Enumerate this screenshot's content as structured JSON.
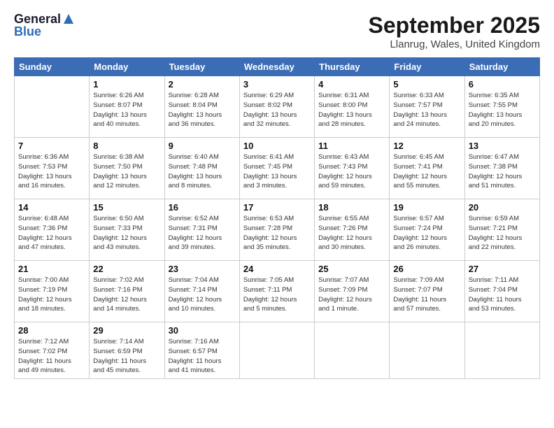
{
  "header": {
    "logo_line1": "General",
    "logo_line2": "Blue",
    "month": "September 2025",
    "location": "Llanrug, Wales, United Kingdom"
  },
  "weekdays": [
    "Sunday",
    "Monday",
    "Tuesday",
    "Wednesday",
    "Thursday",
    "Friday",
    "Saturday"
  ],
  "weeks": [
    [
      {
        "day": "",
        "info": ""
      },
      {
        "day": "1",
        "info": "Sunrise: 6:26 AM\nSunset: 8:07 PM\nDaylight: 13 hours\nand 40 minutes."
      },
      {
        "day": "2",
        "info": "Sunrise: 6:28 AM\nSunset: 8:04 PM\nDaylight: 13 hours\nand 36 minutes."
      },
      {
        "day": "3",
        "info": "Sunrise: 6:29 AM\nSunset: 8:02 PM\nDaylight: 13 hours\nand 32 minutes."
      },
      {
        "day": "4",
        "info": "Sunrise: 6:31 AM\nSunset: 8:00 PM\nDaylight: 13 hours\nand 28 minutes."
      },
      {
        "day": "5",
        "info": "Sunrise: 6:33 AM\nSunset: 7:57 PM\nDaylight: 13 hours\nand 24 minutes."
      },
      {
        "day": "6",
        "info": "Sunrise: 6:35 AM\nSunset: 7:55 PM\nDaylight: 13 hours\nand 20 minutes."
      }
    ],
    [
      {
        "day": "7",
        "info": "Sunrise: 6:36 AM\nSunset: 7:53 PM\nDaylight: 13 hours\nand 16 minutes."
      },
      {
        "day": "8",
        "info": "Sunrise: 6:38 AM\nSunset: 7:50 PM\nDaylight: 13 hours\nand 12 minutes."
      },
      {
        "day": "9",
        "info": "Sunrise: 6:40 AM\nSunset: 7:48 PM\nDaylight: 13 hours\nand 8 minutes."
      },
      {
        "day": "10",
        "info": "Sunrise: 6:41 AM\nSunset: 7:45 PM\nDaylight: 13 hours\nand 3 minutes."
      },
      {
        "day": "11",
        "info": "Sunrise: 6:43 AM\nSunset: 7:43 PM\nDaylight: 12 hours\nand 59 minutes."
      },
      {
        "day": "12",
        "info": "Sunrise: 6:45 AM\nSunset: 7:41 PM\nDaylight: 12 hours\nand 55 minutes."
      },
      {
        "day": "13",
        "info": "Sunrise: 6:47 AM\nSunset: 7:38 PM\nDaylight: 12 hours\nand 51 minutes."
      }
    ],
    [
      {
        "day": "14",
        "info": "Sunrise: 6:48 AM\nSunset: 7:36 PM\nDaylight: 12 hours\nand 47 minutes."
      },
      {
        "day": "15",
        "info": "Sunrise: 6:50 AM\nSunset: 7:33 PM\nDaylight: 12 hours\nand 43 minutes."
      },
      {
        "day": "16",
        "info": "Sunrise: 6:52 AM\nSunset: 7:31 PM\nDaylight: 12 hours\nand 39 minutes."
      },
      {
        "day": "17",
        "info": "Sunrise: 6:53 AM\nSunset: 7:28 PM\nDaylight: 12 hours\nand 35 minutes."
      },
      {
        "day": "18",
        "info": "Sunrise: 6:55 AM\nSunset: 7:26 PM\nDaylight: 12 hours\nand 30 minutes."
      },
      {
        "day": "19",
        "info": "Sunrise: 6:57 AM\nSunset: 7:24 PM\nDaylight: 12 hours\nand 26 minutes."
      },
      {
        "day": "20",
        "info": "Sunrise: 6:59 AM\nSunset: 7:21 PM\nDaylight: 12 hours\nand 22 minutes."
      }
    ],
    [
      {
        "day": "21",
        "info": "Sunrise: 7:00 AM\nSunset: 7:19 PM\nDaylight: 12 hours\nand 18 minutes."
      },
      {
        "day": "22",
        "info": "Sunrise: 7:02 AM\nSunset: 7:16 PM\nDaylight: 12 hours\nand 14 minutes."
      },
      {
        "day": "23",
        "info": "Sunrise: 7:04 AM\nSunset: 7:14 PM\nDaylight: 12 hours\nand 10 minutes."
      },
      {
        "day": "24",
        "info": "Sunrise: 7:05 AM\nSunset: 7:11 PM\nDaylight: 12 hours\nand 5 minutes."
      },
      {
        "day": "25",
        "info": "Sunrise: 7:07 AM\nSunset: 7:09 PM\nDaylight: 12 hours\nand 1 minute."
      },
      {
        "day": "26",
        "info": "Sunrise: 7:09 AM\nSunset: 7:07 PM\nDaylight: 11 hours\nand 57 minutes."
      },
      {
        "day": "27",
        "info": "Sunrise: 7:11 AM\nSunset: 7:04 PM\nDaylight: 11 hours\nand 53 minutes."
      }
    ],
    [
      {
        "day": "28",
        "info": "Sunrise: 7:12 AM\nSunset: 7:02 PM\nDaylight: 11 hours\nand 49 minutes."
      },
      {
        "day": "29",
        "info": "Sunrise: 7:14 AM\nSunset: 6:59 PM\nDaylight: 11 hours\nand 45 minutes."
      },
      {
        "day": "30",
        "info": "Sunrise: 7:16 AM\nSunset: 6:57 PM\nDaylight: 11 hours\nand 41 minutes."
      },
      {
        "day": "",
        "info": ""
      },
      {
        "day": "",
        "info": ""
      },
      {
        "day": "",
        "info": ""
      },
      {
        "day": "",
        "info": ""
      }
    ]
  ]
}
